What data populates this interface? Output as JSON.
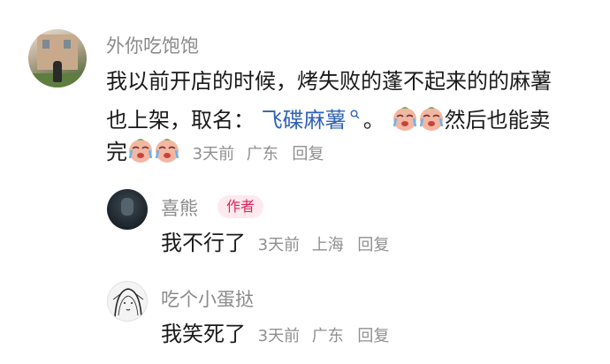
{
  "comments": [
    {
      "username": "外你吃饱饱",
      "text_line1": "我以前开店的时候，烤失败的蓬不起来的的麻薯",
      "text_line2_pre": "也上架，取名：",
      "link_text": "飞碟麻薯",
      "link_icon": "search-icon",
      "text_line2_post": "。",
      "text_line3_pre": "然后也能卖",
      "text_line3_start": "完",
      "emoji_name": "crying-face-emoji",
      "time": "3天前",
      "location": "广东",
      "reply_label": "回复"
    },
    {
      "username": "喜熊",
      "author_badge": "作者",
      "text": "我不行了",
      "time": "3天前",
      "location": "上海",
      "reply_label": "回复"
    },
    {
      "username": "吃个小蛋挞",
      "text": "我笑死了",
      "time": "3天前",
      "location": "广东",
      "reply_label": "回复"
    }
  ],
  "colors": {
    "username": "#8a8a8a",
    "text": "#1a1a1a",
    "link": "#2f62b8",
    "badge_bg": "#fde9ee",
    "badge_text": "#e0245e",
    "meta": "#8f8f8f"
  }
}
